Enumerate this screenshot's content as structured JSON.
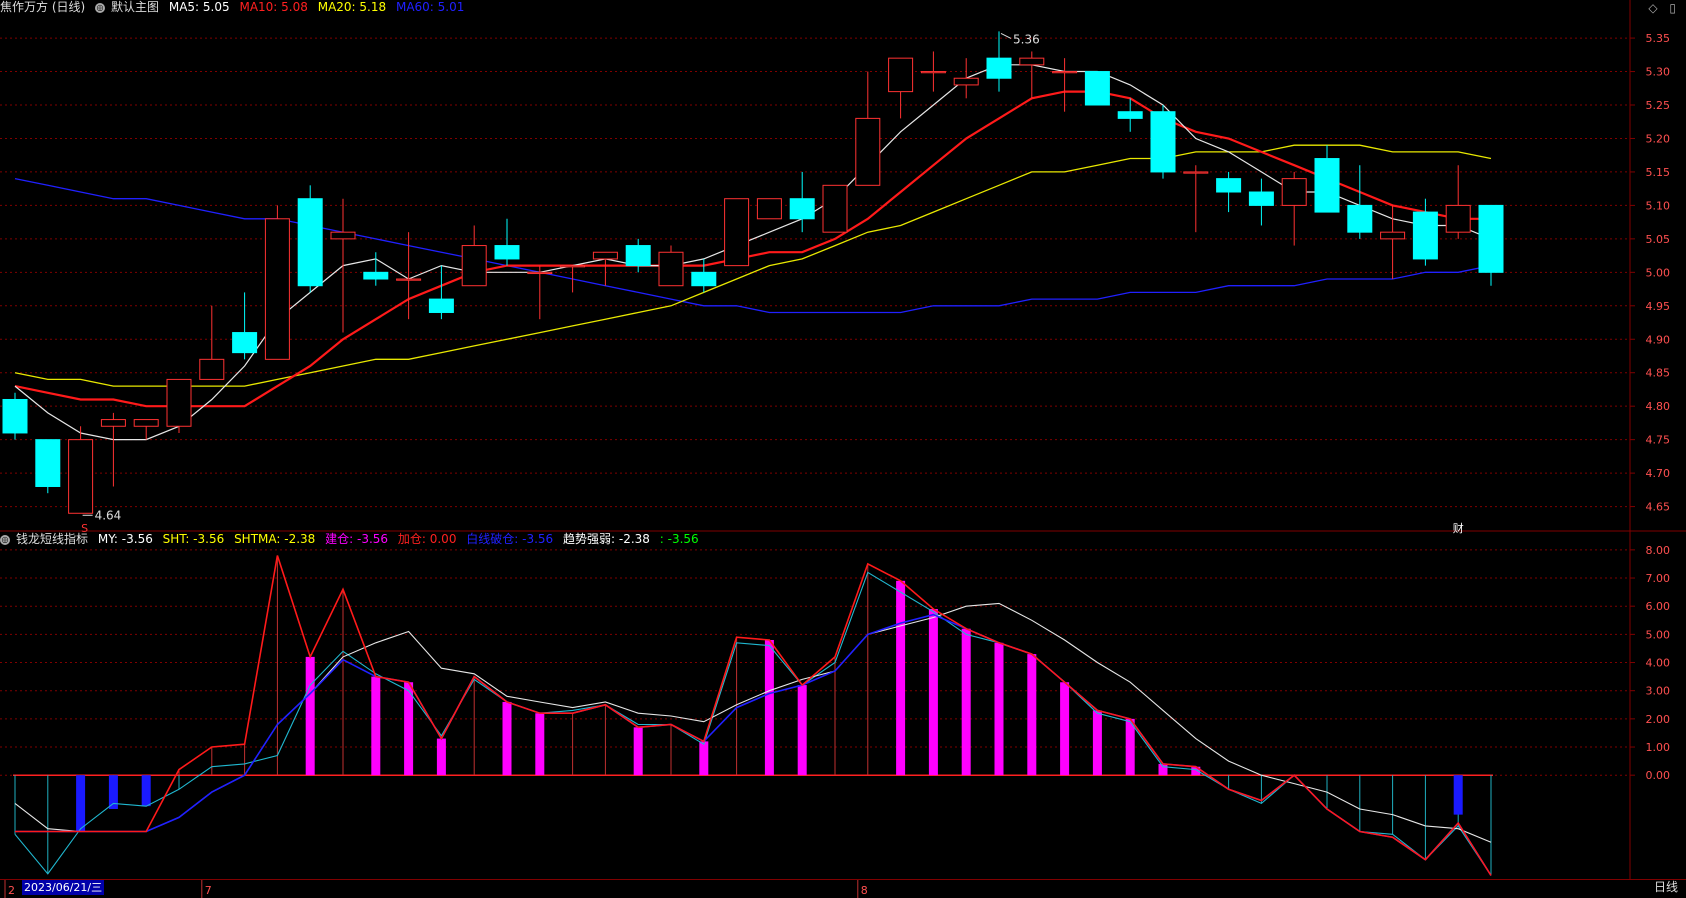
{
  "header": {
    "title": "焦作万方 (日线)",
    "icon": "settings-circle-icon",
    "main_chart_label": "默认主图",
    "ma": [
      {
        "label": "MA5: 5.05",
        "color": "#ffffff"
      },
      {
        "label": "MA10: 5.08",
        "color": "#ff2020"
      },
      {
        "label": "MA20: 5.18",
        "color": "#ffff00"
      },
      {
        "label": "MA60: 5.01",
        "color": "#2020ff"
      }
    ]
  },
  "indicator_header": {
    "name": "钱龙短线指标",
    "items": [
      {
        "label": "MY: -3.56",
        "color": "#ffffff"
      },
      {
        "label": "SHT: -3.56",
        "color": "#ffff00"
      },
      {
        "label": "SHTMA: -2.38",
        "color": "#ffff00"
      },
      {
        "label": "建仓: -3.56",
        "color": "#ff00ff"
      },
      {
        "label": "加仓: 0.00",
        "color": "#ff2020"
      },
      {
        "label": "白线破仓: -3.56",
        "color": "#2020ff"
      },
      {
        "label": "趋势强弱: -2.38",
        "color": "#ffffff"
      },
      {
        "label": ": -3.56",
        "color": "#00ff00"
      }
    ]
  },
  "icons": {
    "diamond": "◇",
    "window": "▯"
  },
  "bottom": {
    "date": "2023/06/21/三",
    "period": "日线",
    "month_marks": [
      "2",
      "7",
      "8"
    ]
  },
  "markers": {
    "low_label": "4.64",
    "high_label": "5.36",
    "finance_badge": "财",
    "ex_marker": "S"
  },
  "colors": {
    "up": "#ff3232",
    "down": "#00ffff",
    "grid": "#800000",
    "axis_text": "#ff5050"
  },
  "chart_data": [
    {
      "type": "candlestick",
      "price_ticks": [
        4.65,
        4.7,
        4.75,
        4.8,
        4.85,
        4.9,
        4.95,
        5.0,
        5.05,
        5.1,
        5.15,
        5.2,
        5.25,
        5.3,
        5.35
      ],
      "ylim": [
        4.615,
        5.38
      ],
      "candles": [
        {
          "o": 4.81,
          "h": 4.82,
          "l": 4.75,
          "c": 4.76
        },
        {
          "o": 4.75,
          "h": 4.75,
          "l": 4.67,
          "c": 4.68
        },
        {
          "o": 4.64,
          "h": 4.77,
          "l": 4.64,
          "c": 4.75
        },
        {
          "o": 4.77,
          "h": 4.79,
          "l": 4.68,
          "c": 4.78
        },
        {
          "o": 4.77,
          "h": 4.78,
          "l": 4.75,
          "c": 4.78
        },
        {
          "o": 4.77,
          "h": 4.84,
          "l": 4.76,
          "c": 4.84
        },
        {
          "o": 4.84,
          "h": 4.95,
          "l": 4.84,
          "c": 4.87
        },
        {
          "o": 4.91,
          "h": 4.97,
          "l": 4.87,
          "c": 4.88
        },
        {
          "o": 4.87,
          "h": 5.1,
          "l": 4.87,
          "c": 5.08
        },
        {
          "o": 5.11,
          "h": 5.13,
          "l": 4.97,
          "c": 4.98
        },
        {
          "o": 5.05,
          "h": 5.11,
          "l": 4.91,
          "c": 5.06
        },
        {
          "o": 5.0,
          "h": 5.03,
          "l": 4.98,
          "c": 4.99
        },
        {
          "o": 4.99,
          "h": 5.06,
          "l": 4.93,
          "c": 4.99
        },
        {
          "o": 4.96,
          "h": 5.01,
          "l": 4.93,
          "c": 4.94
        },
        {
          "o": 4.98,
          "h": 5.07,
          "l": 4.98,
          "c": 5.04
        },
        {
          "o": 5.04,
          "h": 5.08,
          "l": 5.01,
          "c": 5.02
        },
        {
          "o": 5.0,
          "h": 5.01,
          "l": 4.93,
          "c": 5.0
        },
        {
          "o": 5.01,
          "h": 5.01,
          "l": 4.97,
          "c": 5.01
        },
        {
          "o": 5.02,
          "h": 5.03,
          "l": 4.98,
          "c": 5.03
        },
        {
          "o": 5.04,
          "h": 5.05,
          "l": 5.0,
          "c": 5.01
        },
        {
          "o": 4.98,
          "h": 5.04,
          "l": 4.98,
          "c": 5.03
        },
        {
          "o": 5.0,
          "h": 5.02,
          "l": 4.97,
          "c": 4.98
        },
        {
          "o": 5.01,
          "h": 5.11,
          "l": 5.01,
          "c": 5.11
        },
        {
          "o": 5.08,
          "h": 5.11,
          "l": 5.08,
          "c": 5.11
        },
        {
          "o": 5.11,
          "h": 5.15,
          "l": 5.06,
          "c": 5.08
        },
        {
          "o": 5.06,
          "h": 5.13,
          "l": 5.06,
          "c": 5.13
        },
        {
          "o": 5.13,
          "h": 5.3,
          "l": 5.13,
          "c": 5.23
        },
        {
          "o": 5.27,
          "h": 5.32,
          "l": 5.23,
          "c": 5.32
        },
        {
          "o": 5.3,
          "h": 5.33,
          "l": 5.27,
          "c": 5.3
        },
        {
          "o": 5.28,
          "h": 5.32,
          "l": 5.26,
          "c": 5.29
        },
        {
          "o": 5.32,
          "h": 5.36,
          "l": 5.27,
          "c": 5.29
        },
        {
          "o": 5.31,
          "h": 5.33,
          "l": 5.26,
          "c": 5.32
        },
        {
          "o": 5.3,
          "h": 5.32,
          "l": 5.24,
          "c": 5.3
        },
        {
          "o": 5.3,
          "h": 5.3,
          "l": 5.25,
          "c": 5.25
        },
        {
          "o": 5.24,
          "h": 5.26,
          "l": 5.21,
          "c": 5.23
        },
        {
          "o": 5.24,
          "h": 5.25,
          "l": 5.14,
          "c": 5.15
        },
        {
          "o": 5.15,
          "h": 5.16,
          "l": 5.06,
          "c": 5.15
        },
        {
          "o": 5.14,
          "h": 5.15,
          "l": 5.09,
          "c": 5.12
        },
        {
          "o": 5.12,
          "h": 5.14,
          "l": 5.07,
          "c": 5.1
        },
        {
          "o": 5.1,
          "h": 5.15,
          "l": 5.04,
          "c": 5.14
        },
        {
          "o": 5.17,
          "h": 5.19,
          "l": 5.09,
          "c": 5.09
        },
        {
          "o": 5.1,
          "h": 5.16,
          "l": 5.05,
          "c": 5.06
        },
        {
          "o": 5.05,
          "h": 5.1,
          "l": 4.99,
          "c": 5.06
        },
        {
          "o": 5.09,
          "h": 5.11,
          "l": 5.01,
          "c": 5.02
        },
        {
          "o": 5.06,
          "h": 5.16,
          "l": 5.05,
          "c": 5.1
        },
        {
          "o": 5.1,
          "h": 5.1,
          "l": 4.98,
          "c": 5.0
        }
      ],
      "ma5": [
        4.83,
        4.79,
        4.76,
        4.75,
        4.75,
        4.77,
        4.81,
        4.86,
        4.93,
        4.97,
        5.01,
        5.02,
        4.99,
        5.01,
        5.0,
        5.0,
        5.0,
        5.01,
        5.02,
        5.01,
        5.01,
        5.02,
        5.04,
        5.06,
        5.08,
        5.11,
        5.16,
        5.21,
        5.25,
        5.29,
        5.31,
        5.31,
        5.3,
        5.3,
        5.28,
        5.25,
        5.2,
        5.18,
        5.15,
        5.12,
        5.12,
        5.1,
        5.08,
        5.07,
        5.07,
        5.05
      ],
      "ma10": [
        4.83,
        4.82,
        4.81,
        4.81,
        4.8,
        4.8,
        4.8,
        4.8,
        4.83,
        4.86,
        4.9,
        4.93,
        4.96,
        4.98,
        5.0,
        5.01,
        5.01,
        5.01,
        5.01,
        5.01,
        5.01,
        5.01,
        5.02,
        5.03,
        5.03,
        5.05,
        5.08,
        5.12,
        5.16,
        5.2,
        5.23,
        5.26,
        5.27,
        5.27,
        5.26,
        5.23,
        5.21,
        5.2,
        5.18,
        5.16,
        5.14,
        5.12,
        5.1,
        5.09,
        5.08,
        5.08
      ],
      "ma20": [
        4.85,
        4.84,
        4.84,
        4.83,
        4.83,
        4.83,
        4.83,
        4.83,
        4.84,
        4.85,
        4.86,
        4.87,
        4.87,
        4.88,
        4.89,
        4.9,
        4.91,
        4.92,
        4.93,
        4.94,
        4.95,
        4.97,
        4.99,
        5.01,
        5.02,
        5.04,
        5.06,
        5.07,
        5.09,
        5.11,
        5.13,
        5.15,
        5.15,
        5.16,
        5.17,
        5.17,
        5.18,
        5.18,
        5.18,
        5.19,
        5.19,
        5.19,
        5.18,
        5.18,
        5.18,
        5.17
      ],
      "ma60": [
        5.14,
        5.13,
        5.12,
        5.11,
        5.11,
        5.1,
        5.09,
        5.08,
        5.08,
        5.07,
        5.06,
        5.05,
        5.04,
        5.03,
        5.02,
        5.01,
        5.0,
        4.99,
        4.98,
        4.97,
        4.96,
        4.95,
        4.95,
        4.94,
        4.94,
        4.94,
        4.94,
        4.94,
        4.95,
        4.95,
        4.95,
        4.96,
        4.96,
        4.96,
        4.97,
        4.97,
        4.97,
        4.98,
        4.98,
        4.98,
        4.99,
        4.99,
        4.99,
        5.0,
        5.0,
        5.01
      ]
    },
    {
      "type": "indicator",
      "ticks": [
        0,
        1,
        2,
        3,
        4,
        5,
        6,
        7,
        8
      ],
      "ylim": [
        -3.65,
        8.35
      ],
      "red_line": [
        -2.0,
        -2.0,
        -2.0,
        -2.0,
        -2.0,
        0.2,
        1.0,
        1.1,
        7.8,
        4.2,
        6.6,
        3.5,
        3.3,
        1.3,
        3.5,
        2.6,
        2.2,
        2.2,
        2.5,
        1.7,
        1.8,
        1.2,
        4.9,
        4.8,
        3.2,
        4.2,
        7.5,
        6.9,
        5.9,
        5.2,
        4.7,
        4.3,
        3.3,
        2.3,
        2.0,
        0.4,
        0.3,
        -0.5,
        -0.9,
        0.0,
        -1.2,
        -2.0,
        -2.2,
        -3.0,
        -1.7,
        -3.56
      ],
      "blue_line": [
        -2.0,
        -2.0,
        -2.0,
        -2.0,
        -2.0,
        -1.5,
        -0.6,
        0.0,
        1.8,
        2.9,
        4.1,
        3.5,
        3.3,
        1.3,
        3.5,
        2.6,
        2.2,
        2.2,
        2.5,
        1.7,
        1.8,
        1.2,
        2.4,
        2.9,
        3.2,
        3.7,
        5.0,
        5.4,
        5.7,
        5.2,
        4.7,
        4.3,
        3.3,
        2.3,
        2.0,
        0.4,
        0.3,
        -0.5,
        -0.9,
        0.0,
        -1.2,
        -2.0,
        -2.2,
        -3.0,
        -1.7,
        -3.56
      ],
      "white_line": [
        -1.0,
        -1.9,
        -2.0,
        -2.0,
        -2.0,
        -1.5,
        -0.6,
        0.0,
        1.8,
        2.9,
        4.2,
        4.7,
        5.1,
        3.8,
        3.6,
        2.8,
        2.6,
        2.4,
        2.6,
        2.2,
        2.1,
        1.9,
        2.5,
        3.0,
        3.4,
        3.7,
        5.0,
        5.3,
        5.6,
        6.0,
        6.1,
        5.5,
        4.8,
        4.0,
        3.3,
        2.3,
        1.3,
        0.5,
        0.0,
        -0.3,
        -0.6,
        -1.2,
        -1.4,
        -1.8,
        -1.9,
        -2.38
      ],
      "cyan_line": [
        -2.1,
        -3.5,
        -1.9,
        -1.0,
        -1.1,
        -0.5,
        0.3,
        0.4,
        0.7,
        3.2,
        4.4,
        3.6,
        3.0,
        1.4,
        3.4,
        2.6,
        2.2,
        2.3,
        2.5,
        1.8,
        1.8,
        1.1,
        4.7,
        4.6,
        3.2,
        4.0,
        7.2,
        6.5,
        5.8,
        5.0,
        4.7,
        4.3,
        3.3,
        2.2,
        1.9,
        0.3,
        0.2,
        -0.5,
        -1.0,
        0.0,
        -1.2,
        -2.0,
        -2.1,
        -3.0,
        -1.8,
        -3.56
      ],
      "histogram": [
        0.0,
        0.0,
        -2.0,
        -1.2,
        -1.1,
        0.0,
        0.0,
        0.0,
        0.0,
        4.2,
        0.0,
        3.5,
        3.3,
        1.3,
        0.0,
        2.6,
        2.2,
        0.0,
        0.0,
        1.7,
        0.0,
        1.2,
        0.0,
        4.8,
        3.2,
        0.0,
        0.0,
        6.9,
        5.9,
        5.2,
        4.7,
        4.3,
        3.3,
        2.3,
        2.0,
        0.4,
        0.3,
        0.0,
        0.0,
        0.0,
        0.0,
        0.0,
        0.0,
        0.0,
        -1.4,
        0.0
      ]
    }
  ]
}
